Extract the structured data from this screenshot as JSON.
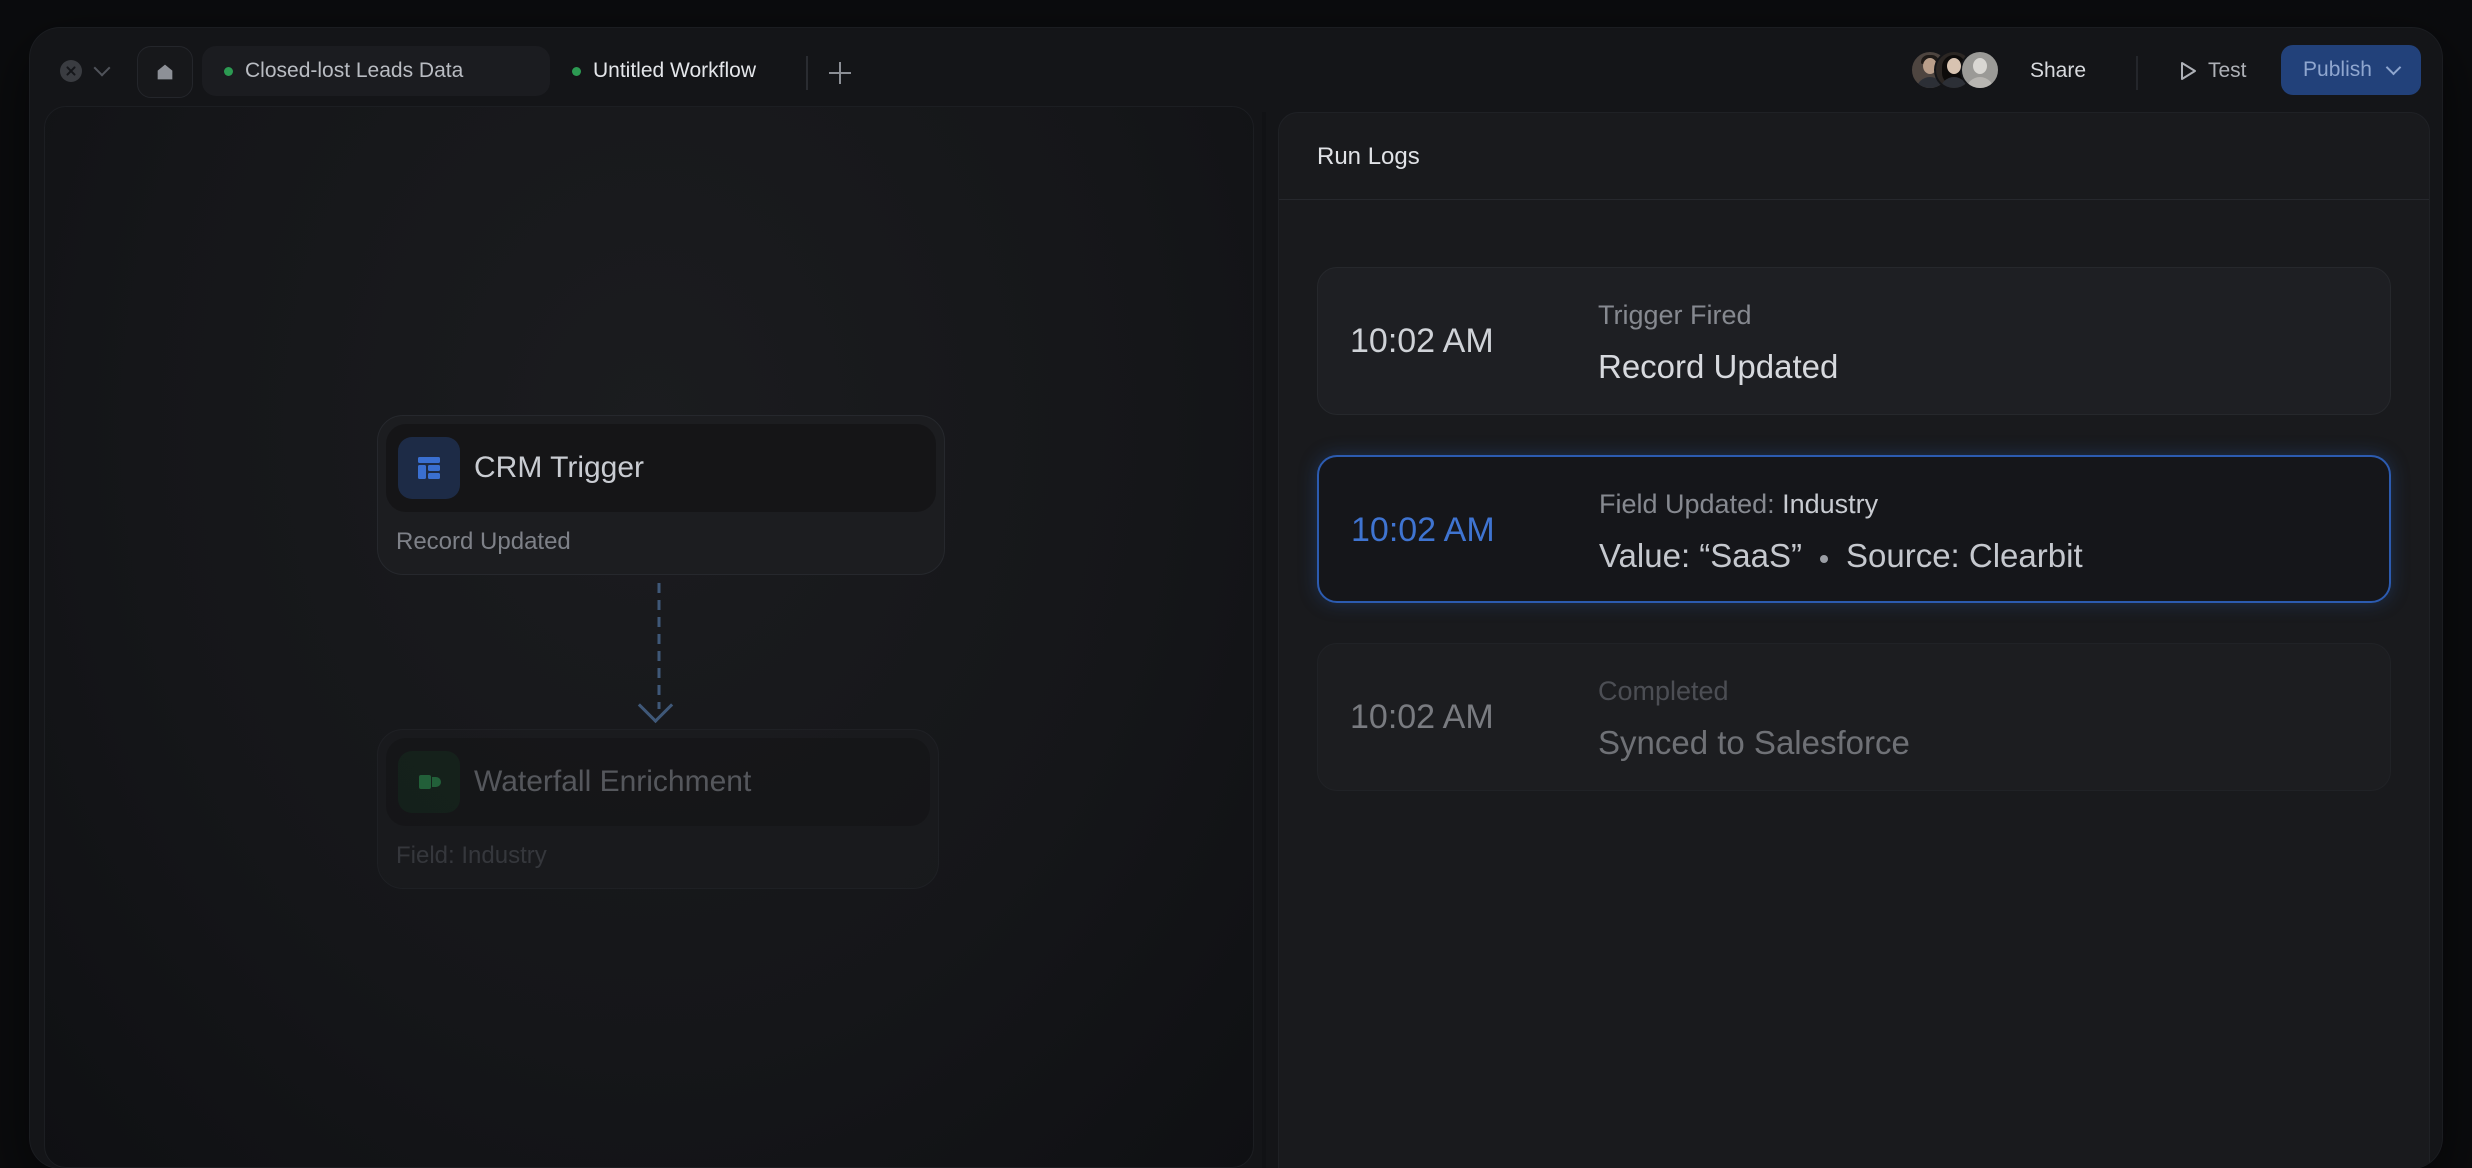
{
  "topbar": {
    "tabs": [
      {
        "label": "Closed-lost Leads Data",
        "status_color": "#2c9a52"
      },
      {
        "label": "Untitled Workflow",
        "status_color": "#2c9a52"
      }
    ],
    "share_label": "Share",
    "test_label": "Test",
    "publish_label": "Publish",
    "accent_color": "#22417a"
  },
  "workflow": {
    "nodes": [
      {
        "title": "CRM Trigger",
        "subtitle": "Record Updated",
        "icon": "table-icon"
      },
      {
        "title": "Waterfall Enrichment",
        "subtitle": "Field: Industry",
        "icon": "enrichment-icon"
      }
    ]
  },
  "run_logs": {
    "title": "Run Logs",
    "entries": [
      {
        "time": "10:02 AM",
        "label": "Trigger Fired",
        "detail": "Record Updated"
      },
      {
        "time": "10:02 AM",
        "label_prefix": "Field Updated:",
        "label_value": "Industry",
        "detail_value": "Value: “SaaS”",
        "detail_source": "Source: Clearbit",
        "highlight_color": "#2c5bb0"
      },
      {
        "time": "10:02 AM",
        "label": "Completed",
        "detail": "Synced to Salesforce"
      }
    ]
  }
}
